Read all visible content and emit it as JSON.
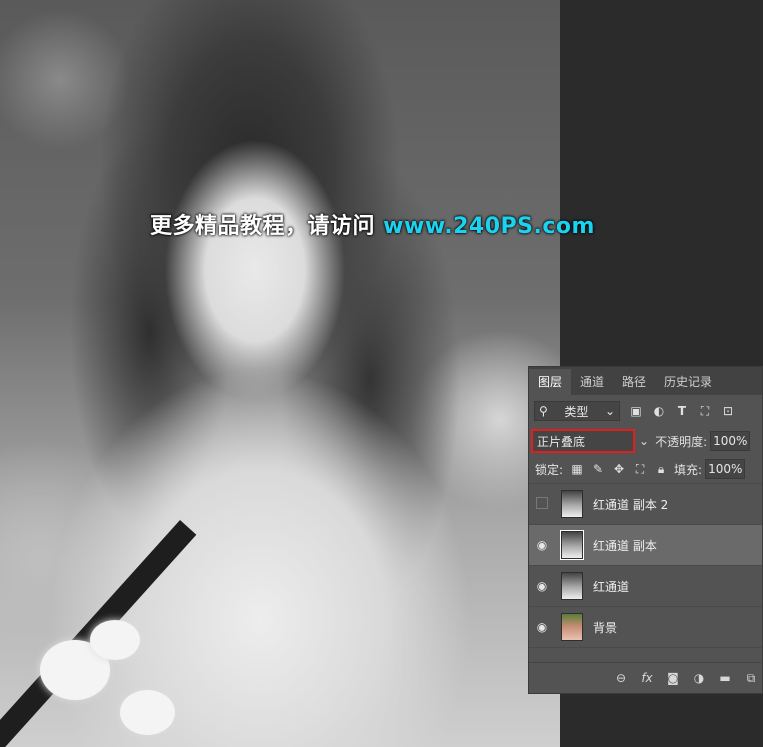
{
  "watermark": {
    "text": "更多精品教程，请访问 ",
    "url": "www.240PS.com"
  },
  "panel": {
    "tabs": [
      {
        "label": "图层"
      },
      {
        "label": "通道"
      },
      {
        "label": "路径"
      },
      {
        "label": "历史记录"
      }
    ],
    "filter": {
      "kind_label": "类型",
      "icons": [
        "image-filter-icon",
        "adjustment-filter-icon",
        "type-filter-icon",
        "shape-filter-icon",
        "smart-object-filter-icon"
      ]
    },
    "blend_mode": "正片叠底",
    "opacity_label": "不透明度:",
    "opacity_value": "100%",
    "lock_label": "锁定:",
    "fill_label": "填充:",
    "fill_value": "100%",
    "layers": [
      {
        "name": "红通道 副本 2",
        "visible": false,
        "selected": false
      },
      {
        "name": "红通道 副本",
        "visible": true,
        "selected": true
      },
      {
        "name": "红通道",
        "visible": true,
        "selected": false
      },
      {
        "name": "背景",
        "visible": true,
        "selected": false
      }
    ],
    "bottom_icons": [
      "link-icon",
      "fx-icon",
      "mask-icon",
      "adjustment-icon",
      "folder-icon",
      "new-layer-icon"
    ]
  },
  "colors": {
    "accent_border": "#e01f1f",
    "watermark_url": "#19d3f0",
    "panel_bg": "#535353"
  }
}
